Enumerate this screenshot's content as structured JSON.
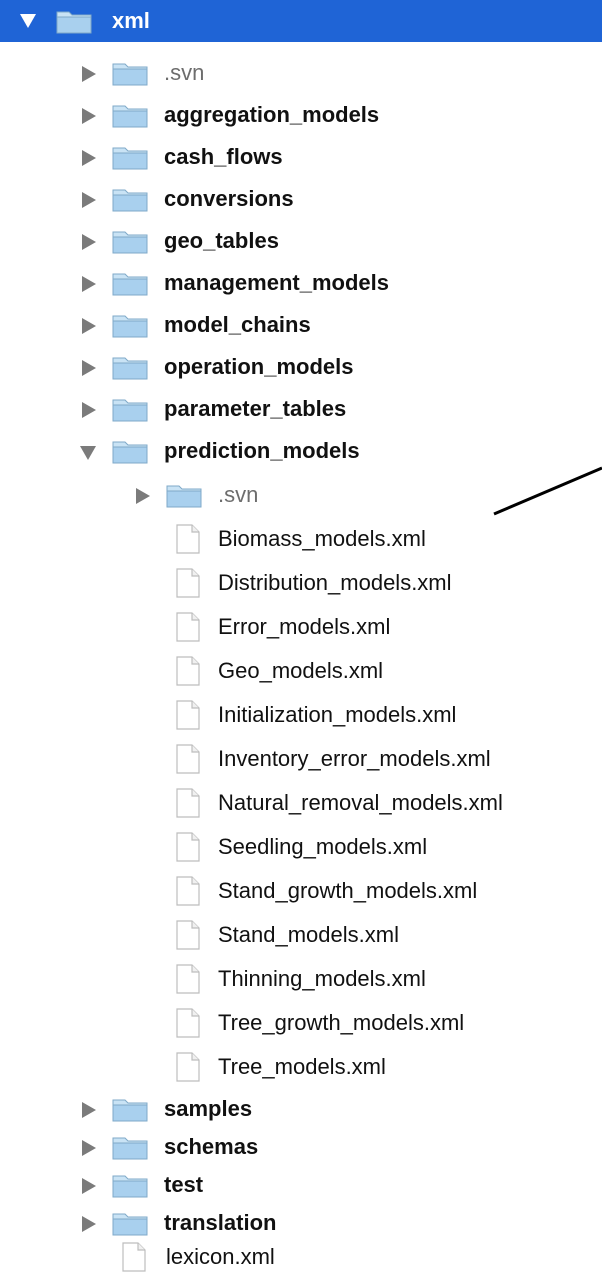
{
  "tree": {
    "root": {
      "label": "xml"
    },
    "level1_top": [
      {
        "label": ".svn"
      },
      {
        "label": "aggregation_models"
      },
      {
        "label": "cash_flows"
      },
      {
        "label": "conversions"
      },
      {
        "label": "geo_tables"
      },
      {
        "label": "management_models"
      },
      {
        "label": "model_chains"
      },
      {
        "label": "operation_models"
      },
      {
        "label": "parameter_tables"
      }
    ],
    "prediction_models": {
      "label": "prediction_models",
      "svn": {
        "label": ".svn"
      },
      "files": [
        {
          "label": "Biomass_models.xml"
        },
        {
          "label": "Distribution_models.xml"
        },
        {
          "label": "Error_models.xml"
        },
        {
          "label": "Geo_models.xml"
        },
        {
          "label": "Initialization_models.xml"
        },
        {
          "label": "Inventory_error_models.xml"
        },
        {
          "label": "Natural_removal_models.xml"
        },
        {
          "label": "Seedling_models.xml"
        },
        {
          "label": "Stand_growth_models.xml"
        },
        {
          "label": "Stand_models.xml"
        },
        {
          "label": "Thinning_models.xml"
        },
        {
          "label": "Tree_growth_models.xml"
        },
        {
          "label": "Tree_models.xml"
        }
      ]
    },
    "level1_bottom": [
      {
        "label": "samples"
      },
      {
        "label": "schemas"
      },
      {
        "label": "test"
      },
      {
        "label": "translation"
      }
    ],
    "root_file": {
      "label": "lexicon.xml"
    }
  },
  "colors": {
    "selection": "#1f64d6",
    "folder": "#9dc6e6",
    "disclosure": "#7b7b7b"
  }
}
